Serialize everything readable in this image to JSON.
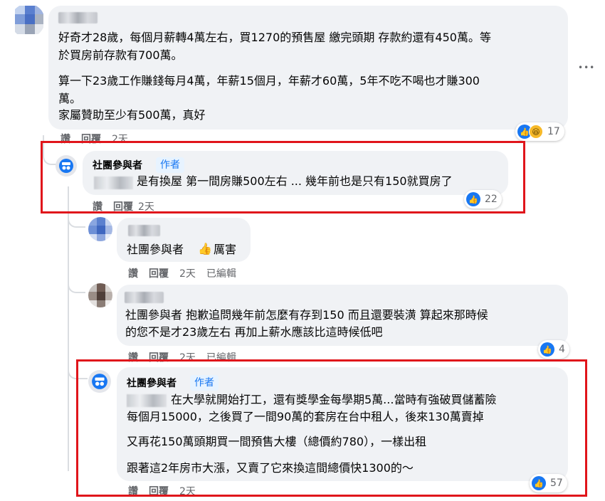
{
  "comment_main": {
    "line1": "好奇才28歲，每個月薪轉4萬左右，買1270的預售屋 繳完頭期 存款約還有450萬。等",
    "line2": "於買房前存款有700萬。",
    "line3": "算一下23歲工作賺錢每月4萬，年薪15個月，年薪才60萬，5年不吃不喝也才賺300",
    "line4": "萬。",
    "line5": "家屬贊助至少有500萬，真好",
    "actions": {
      "like": "讚",
      "reply": "回覆",
      "time": "2天"
    },
    "reaction_count": "17",
    "more": "•••"
  },
  "reply1": {
    "author": "社團參與者",
    "badge": "作者",
    "text": "是有換屋 第一間房賺500左右 ... 幾年前也是只有150就買房了",
    "actions": {
      "like": "讚",
      "reply": "回覆",
      "time": "2天"
    },
    "reaction_count": "22"
  },
  "reply2": {
    "mention": "社團參與者",
    "text": "厲害",
    "actions": {
      "like": "讚",
      "reply": "回覆",
      "time": "2天",
      "edited": "已編輯"
    }
  },
  "reply3": {
    "line1": "社團參與者 抱歉追問幾年前怎麼有存到150 而且還要裝潢 算起來那時候",
    "line2": "的您不是才23歲左右 再加上薪水應該比這時候低吧",
    "actions": {
      "like": "讚",
      "reply": "回覆",
      "time": "2天",
      "edited": "已編輯"
    },
    "reaction_count": "4"
  },
  "reply4": {
    "author": "社團參與者",
    "badge": "作者",
    "line1": "在大學就開始打工，還有獎學金每學期5萬...當時有強破買儲蓄險",
    "line2": "每個月15000，之後買了一間90萬的套房在台中租人，後來130萬賣掉",
    "line3": "又再花150萬頭期買一間預售大樓（總價約780），一樣出租",
    "line4": "跟著這2年房市大漲，又賣了它來換這間總價快1300的～",
    "actions": {
      "like": "讚",
      "reply": "回覆",
      "time": "2天"
    },
    "reaction_count": "57"
  },
  "colors": {
    "highlight_box": "#e0151b",
    "like_blue": "#1877f2",
    "bubble": "#f0f2f5"
  }
}
